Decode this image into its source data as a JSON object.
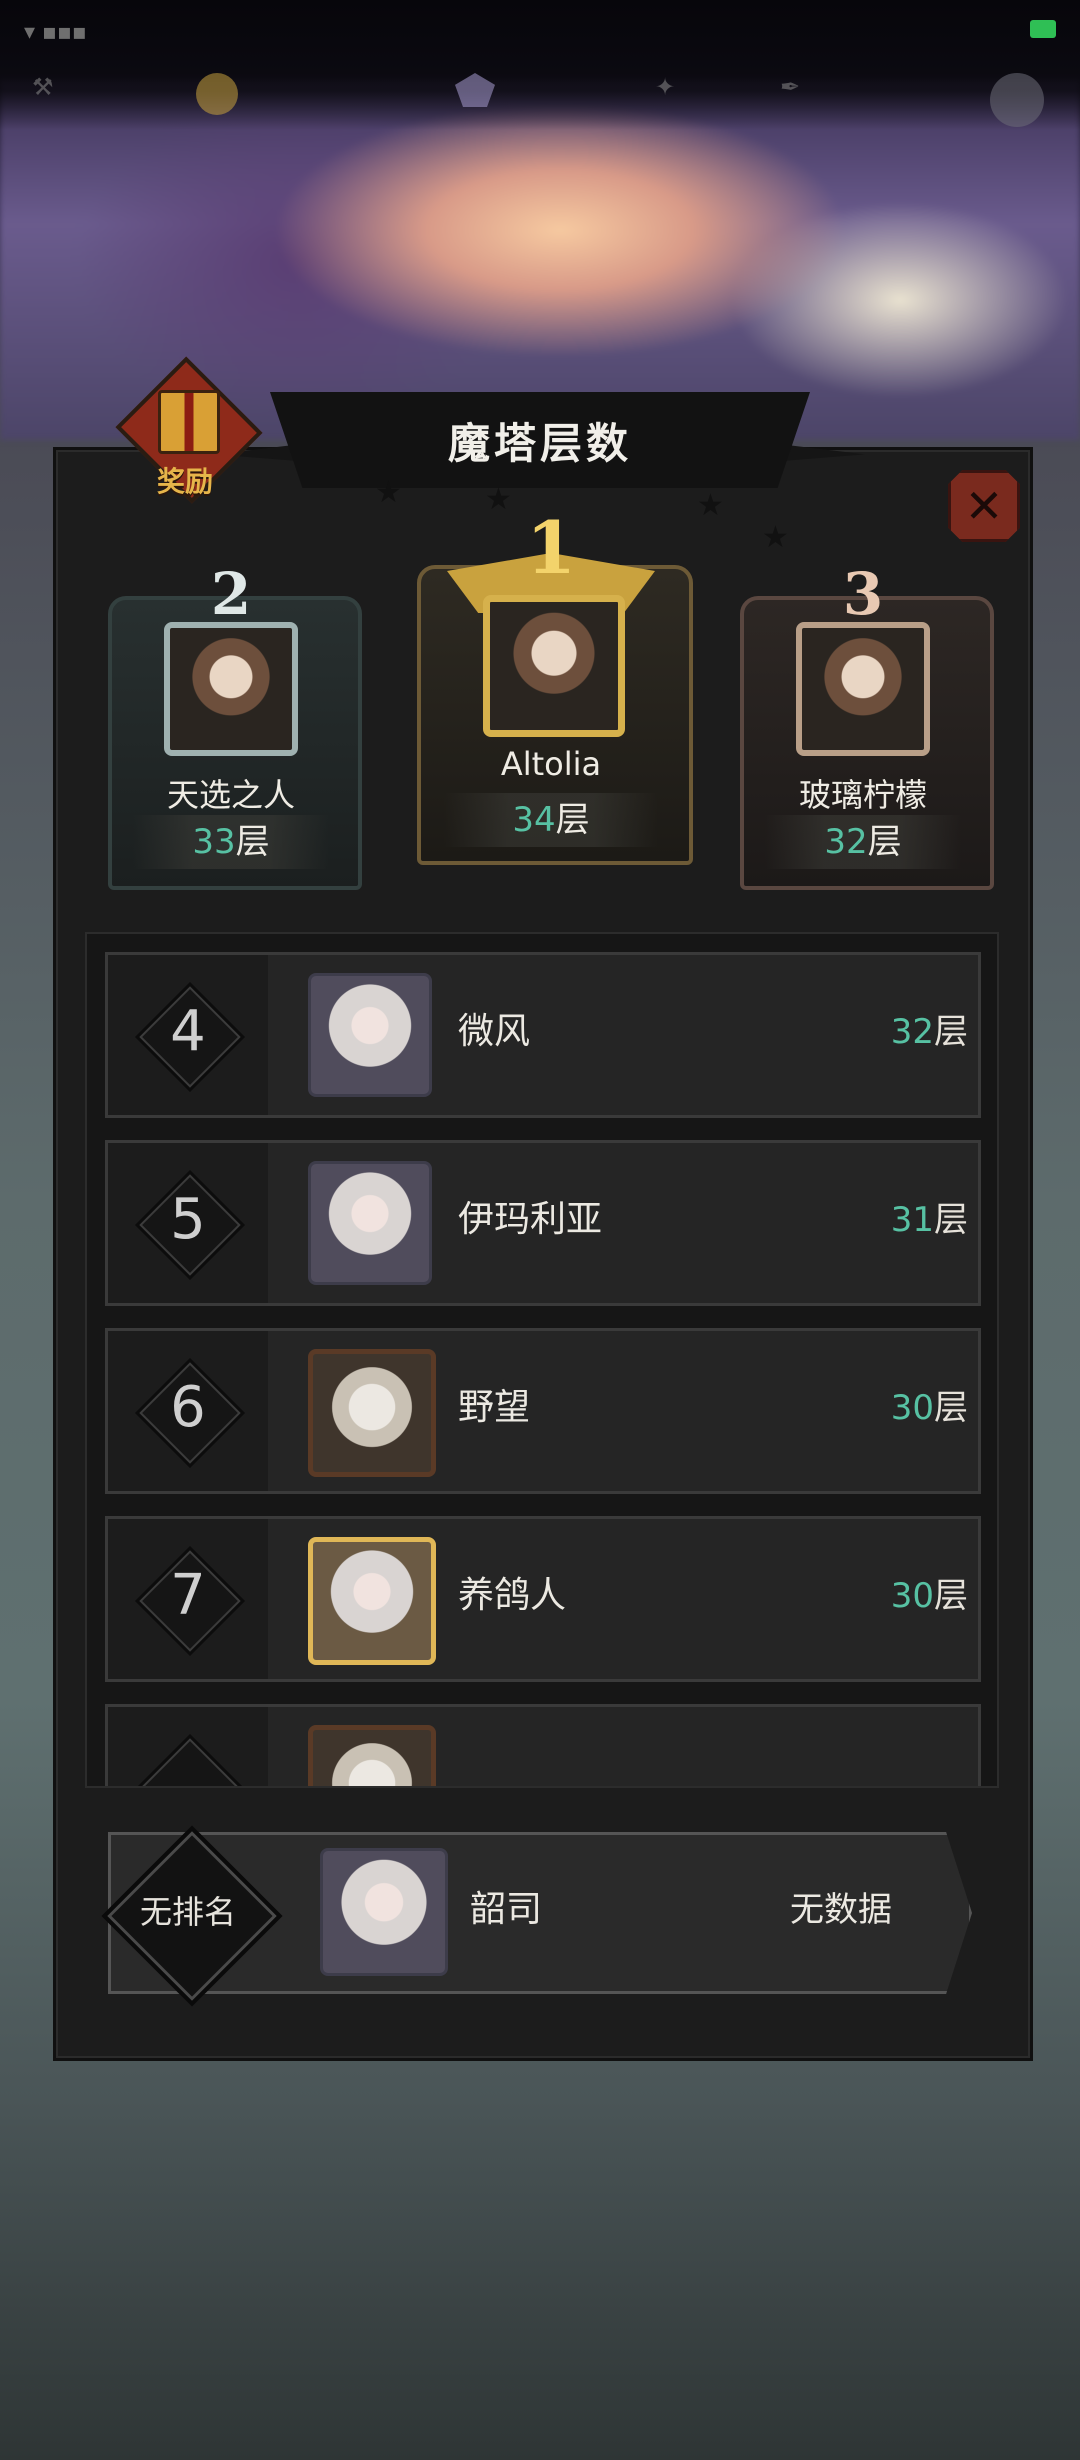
{
  "title": "魔塔层数",
  "reward_label": "奖励",
  "podium": [
    {
      "rank": "2",
      "name": "天选之人",
      "score": "33",
      "unit": "层"
    },
    {
      "rank": "1",
      "name": "Altolia",
      "score": "34",
      "unit": "层"
    },
    {
      "rank": "3",
      "name": "玻璃柠檬",
      "score": "32",
      "unit": "层"
    }
  ],
  "list": [
    {
      "rank": "4",
      "name": "微风",
      "score": "32",
      "unit": "层"
    },
    {
      "rank": "5",
      "name": "伊玛利亚",
      "score": "31",
      "unit": "层"
    },
    {
      "rank": "6",
      "name": "野望",
      "score": "30",
      "unit": "层"
    },
    {
      "rank": "7",
      "name": "养鸽人",
      "score": "30",
      "unit": "层"
    }
  ],
  "self": {
    "rank_label": "无排名",
    "name": "韶司",
    "score": "无数据"
  },
  "colors": {
    "accent": "#57c1a3",
    "close_bg": "#7a2a1e",
    "panel_bg": "#1c1c1c"
  },
  "icons": {
    "reward": "gift-box-icon",
    "close": "close-icon"
  }
}
